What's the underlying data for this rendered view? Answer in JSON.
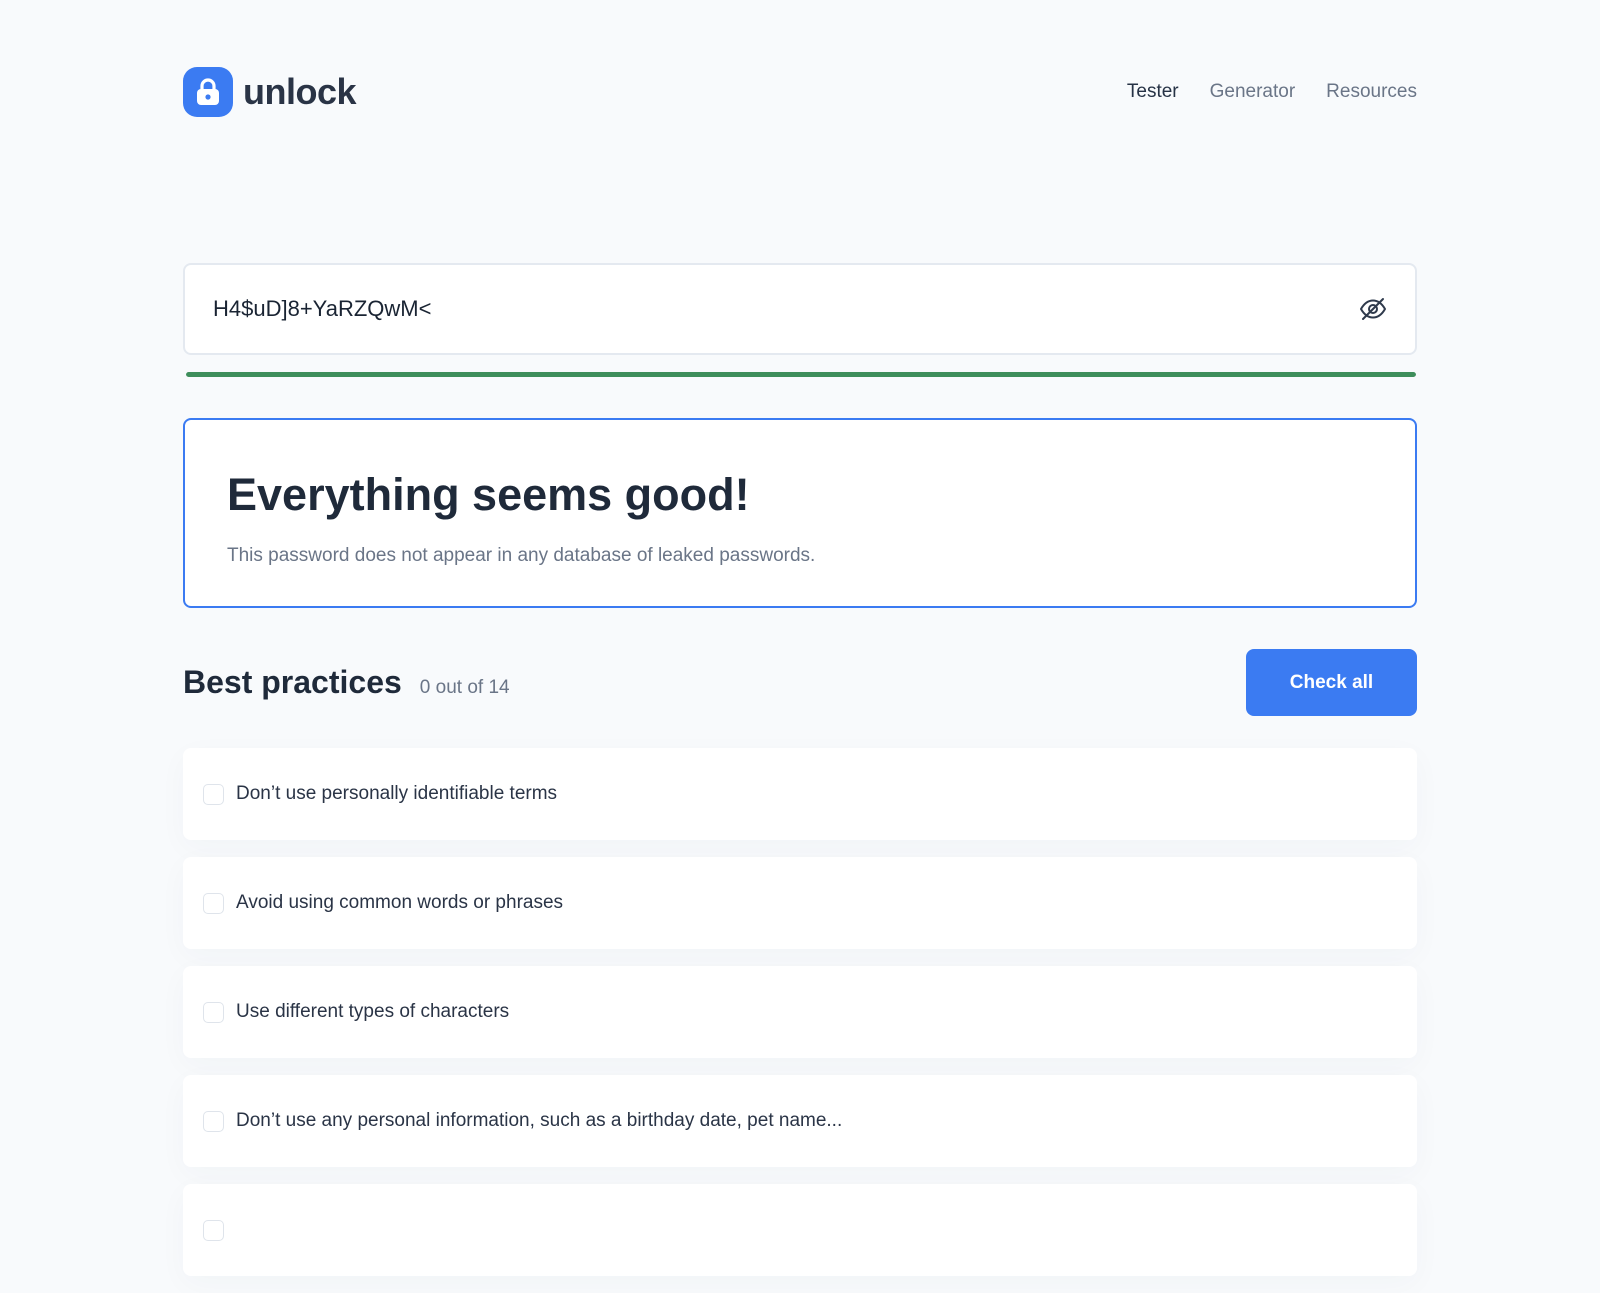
{
  "brand": {
    "name": "unlock",
    "accent_color": "#3b7bf2"
  },
  "nav": {
    "items": [
      {
        "label": "Tester",
        "active": true
      },
      {
        "label": "Generator",
        "active": false
      },
      {
        "label": "Resources",
        "active": false
      }
    ]
  },
  "password": {
    "value": "H4$uD]8+YaRZQwM<",
    "toggle_icon": "eye-off-icon"
  },
  "strength": {
    "percent": 100,
    "color": "#3e8e5b"
  },
  "result": {
    "title": "Everything seems good!",
    "description": "This password does not appear in any database of leaked passwords.",
    "border_color": "#3b7bf2"
  },
  "best_practices": {
    "title": "Best practices",
    "count_text": "0 out of 14",
    "check_all_label": "Check all",
    "items": [
      {
        "label": "Don’t use personally identifiable terms",
        "checked": false
      },
      {
        "label": "Avoid using common words or phrases",
        "checked": false
      },
      {
        "label": "Use different types of characters",
        "checked": false
      },
      {
        "label": "Don’t use any personal information, such as a birthday date, pet name...",
        "checked": false
      },
      {
        "label": "",
        "checked": false
      }
    ]
  }
}
